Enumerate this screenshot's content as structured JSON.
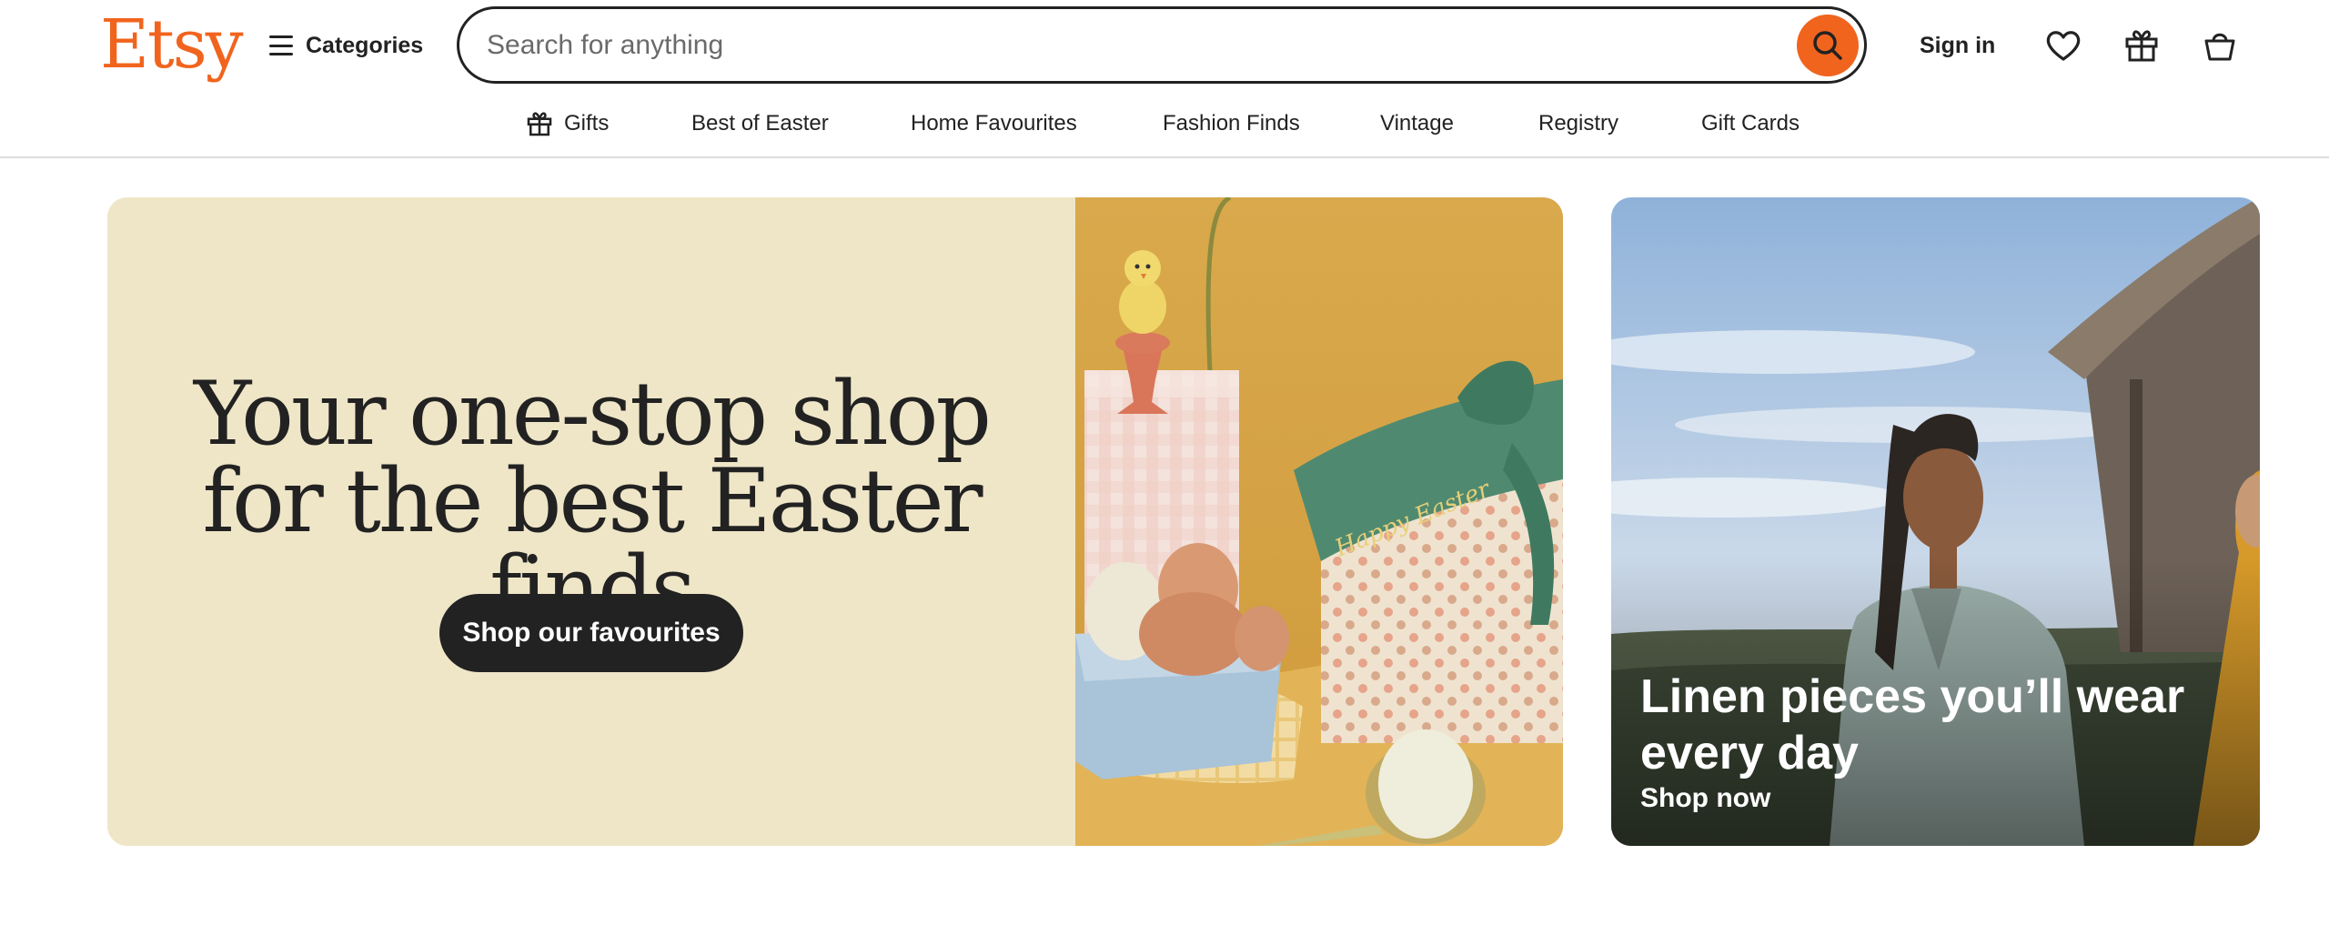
{
  "header": {
    "logo": "Etsy",
    "categories_label": "Categories",
    "search_placeholder": "Search for anything",
    "sign_in_label": "Sign in",
    "icons": [
      "menu-icon",
      "search-icon",
      "heart-icon",
      "gift-icon",
      "shopping-bag-icon"
    ]
  },
  "subnav": {
    "items": [
      {
        "label": "Gifts",
        "icon": "gift-icon"
      },
      {
        "label": "Best of Easter"
      },
      {
        "label": "Home Favourites"
      },
      {
        "label": "Fashion Finds"
      },
      {
        "label": "Vintage"
      },
      {
        "label": "Registry"
      },
      {
        "label": "Gift Cards"
      }
    ]
  },
  "hero": {
    "title": "Your one-stop shop for the best Easter finds",
    "button_label": "Shop our favourites",
    "ribbon_text": "Happy Easter"
  },
  "promo": {
    "title": "Linen pieces you’ll wear every day",
    "link_label": "Shop now"
  },
  "colors": {
    "brand_orange": "#f1641e",
    "text_dark": "#222222",
    "hero_cream": "#efe6c8",
    "hero_mustard": "#d7a548"
  }
}
